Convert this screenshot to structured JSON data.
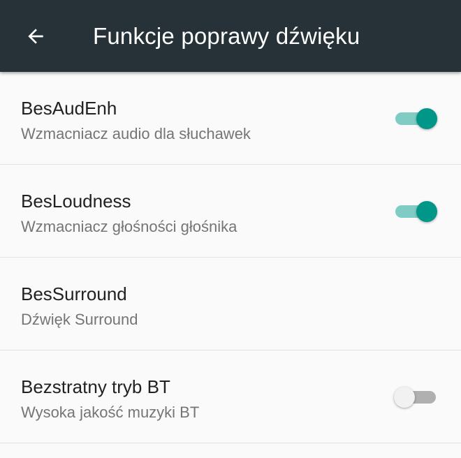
{
  "header": {
    "title": "Funkcje poprawy dźwięku",
    "back_icon": "arrow-back-icon"
  },
  "settings": [
    {
      "title": "BesAudEnh",
      "subtitle": "Wzmacniacz audio dla słuchawek",
      "toggle": true
    },
    {
      "title": "BesLoudness",
      "subtitle": "Wzmacniacz głośności głośnika",
      "toggle": true
    },
    {
      "title": "BesSurround",
      "subtitle": "Dźwięk Surround",
      "toggle": null
    },
    {
      "title": "Bezstratny tryb BT",
      "subtitle": "Wysoka jakość muzyki BT",
      "toggle": false
    }
  ],
  "colors": {
    "app_bar": "#263238",
    "accent": "#009688",
    "accent_track": "#80cbc4",
    "off_track": "#b0b0b0",
    "off_thumb": "#f1f1f1"
  }
}
